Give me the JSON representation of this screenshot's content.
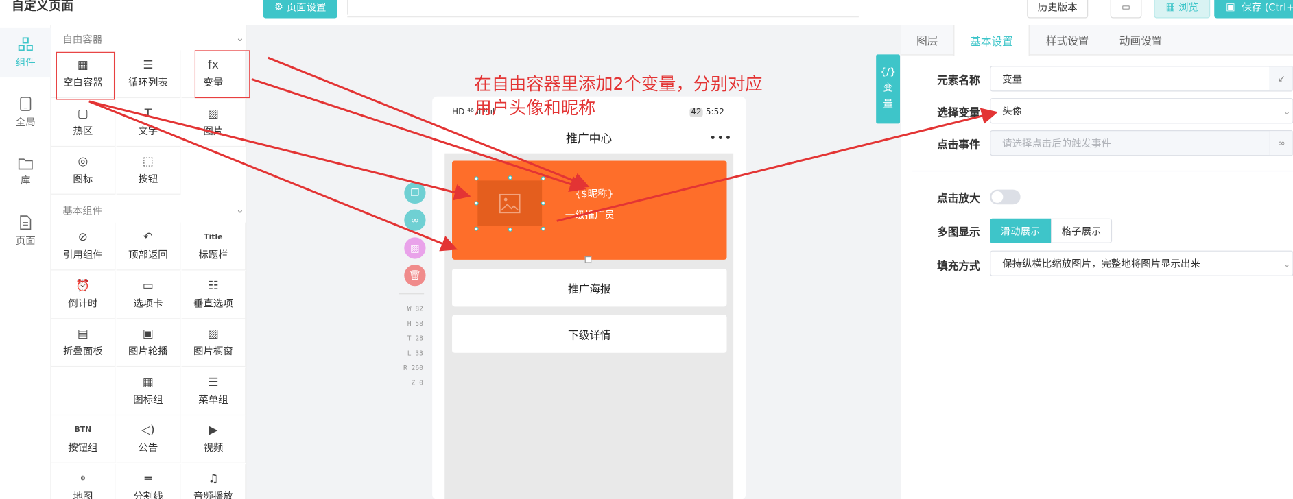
{
  "app": {
    "title": "自定义页面"
  },
  "toolbar": {
    "page_settings": "页面设置",
    "history": "历史版本",
    "preview": "浏览",
    "save": "保存 (Ctrl+S"
  },
  "left_nav": [
    {
      "label": "组件",
      "icon": "grid-icon"
    },
    {
      "label": "全局",
      "icon": "tablet-icon"
    },
    {
      "label": "库",
      "icon": "folder-icon"
    },
    {
      "label": "页面",
      "icon": "page-icon"
    }
  ],
  "free_container": {
    "title": "自由容器",
    "items": [
      {
        "label": "空白容器",
        "glyph": "▦"
      },
      {
        "label": "循环列表",
        "glyph": "☰"
      },
      {
        "label": "变量",
        "glyph": "fx"
      },
      {
        "label": "热区",
        "glyph": "▢"
      },
      {
        "label": "文字",
        "glyph": "T"
      },
      {
        "label": "图片",
        "glyph": "▨"
      },
      {
        "label": "图标",
        "glyph": "◎"
      },
      {
        "label": "按钮",
        "glyph": "⬚"
      }
    ]
  },
  "basic_components": {
    "title": "基本组件",
    "items": [
      {
        "label": "引用组件",
        "glyph": "⊘"
      },
      {
        "label": "顶部返回",
        "glyph": "↶"
      },
      {
        "label": "标题栏",
        "glyph": "Title"
      },
      {
        "label": "倒计时",
        "glyph": "⏰"
      },
      {
        "label": "选项卡",
        "glyph": "▭"
      },
      {
        "label": "垂直选项",
        "glyph": "☷"
      },
      {
        "label": "折叠面板",
        "glyph": "▤"
      },
      {
        "label": "图片轮播",
        "glyph": "▣"
      },
      {
        "label": "图片橱窗",
        "glyph": "▨"
      },
      {
        "label": "",
        "glyph": ""
      },
      {
        "label": "图标组",
        "glyph": "▦"
      },
      {
        "label": "菜单组",
        "glyph": "☰"
      },
      {
        "label": "按钮组",
        "glyph": "BTN"
      },
      {
        "label": "公告",
        "glyph": "◁)"
      },
      {
        "label": "视频",
        "glyph": "▶"
      },
      {
        "label": "地图",
        "glyph": "⌖"
      },
      {
        "label": "分割线",
        "glyph": "═"
      },
      {
        "label": "音频播放",
        "glyph": "♫"
      }
    ]
  },
  "phone": {
    "status_left": "HD ⁴⁶.ıl ᴴ.ıl",
    "battery": "42",
    "time": "5:52",
    "title": "推广中心",
    "nickname": "{$昵称}",
    "level": "一级推广员",
    "card1": "推广海报",
    "card2": "下级详情"
  },
  "metrics": [
    "W 82",
    "H 58",
    "T 28",
    "L 33",
    "R 260",
    "Z 0"
  ],
  "annotation": {
    "line1": "在自由容器里添加2个变量，分别对应",
    "line2": "用户头像和昵称"
  },
  "var_tab": {
    "icon": "{/}",
    "label1": "变",
    "label2": "量"
  },
  "right_tabs": [
    "图层",
    "基本设置",
    "样式设置",
    "动画设置"
  ],
  "form": {
    "element_name_label": "元素名称",
    "element_name_value": "变量",
    "select_var_label": "选择变量",
    "select_var_value": "头像",
    "click_event_label": "点击事件",
    "click_event_placeholder": "请选择点击后的触发事件",
    "zoom_label": "点击放大",
    "multi_label": "多图显示",
    "multi_opt1": "滑动展示",
    "multi_opt2": "格子展示",
    "fill_label": "填充方式",
    "fill_value": "保持纵横比缩放图片，完整地将图片显示出来"
  },
  "colors": {
    "accent": "#3ec5c9",
    "banner": "#fe6e2a",
    "annotation": "#e33434"
  }
}
